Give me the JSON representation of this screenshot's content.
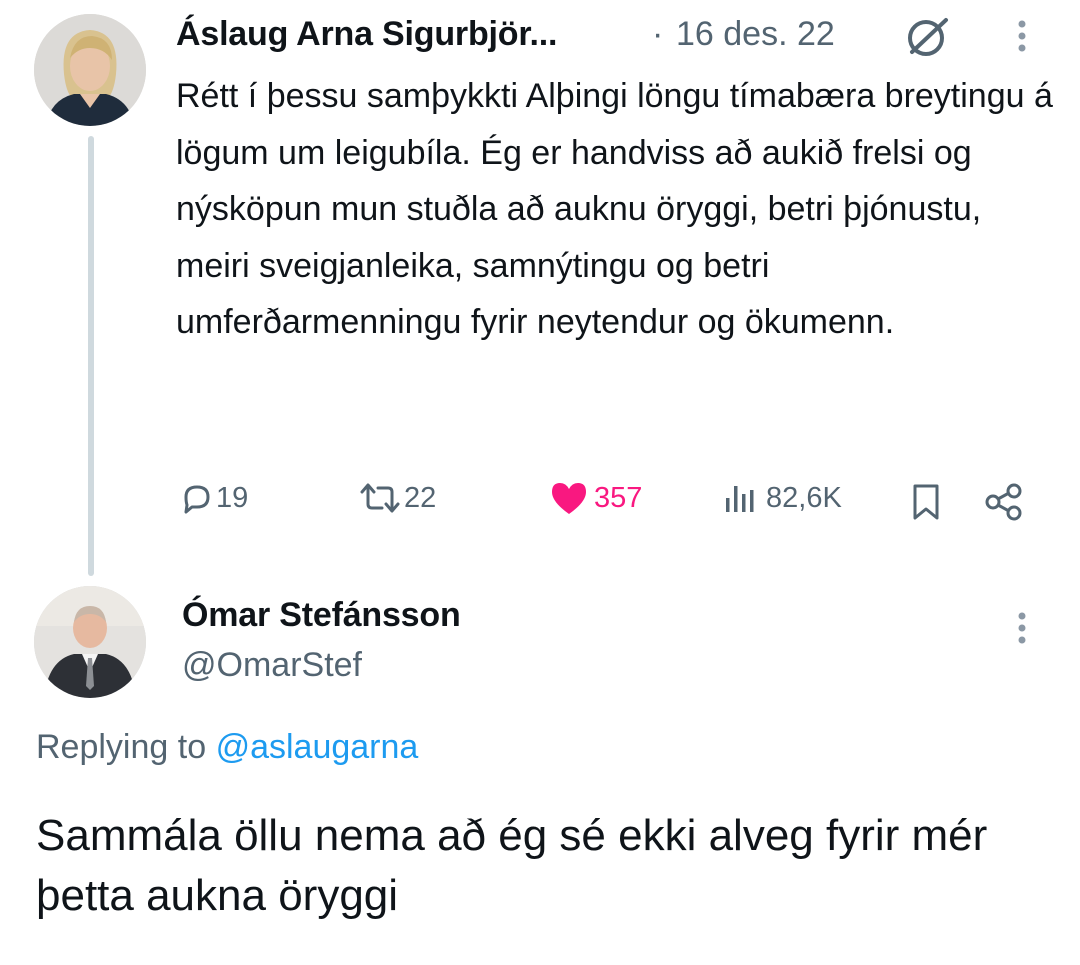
{
  "tweet": {
    "author_name": "Áslaug Arna Sigurbjör...",
    "separator": "·",
    "date": "16 des. 22",
    "text": "Rétt í þessu samþykkti Alþingi löngu tímabæra breytingu á lögum um leigubíla. Ég er handviss að aukið frelsi og nýsköpun mun stuðla að auknu öryggi, betri þjónustu, meiri sveigjanleika, samnýtingu og betri umferðarmenningu fyrir neytendur og ökumenn.",
    "actions": {
      "replies": "19",
      "retweets": "22",
      "likes": "357",
      "views": "82,6K"
    },
    "colors": {
      "like": "#f91880",
      "muted": "#536471"
    }
  },
  "reply": {
    "author_name": "Ómar Stefánsson",
    "handle": "@OmarStef",
    "replying_prefix": "Replying to",
    "replying_handle": "@aslaugarna",
    "text": "Sammála öllu nema að ég sé ekki alveg fyrir mér þetta aukna öryggi",
    "colors": {
      "link": "#1d9bf0"
    }
  },
  "icons": {
    "no_entry": "circle-slash-icon",
    "more": "more-vertical-icon",
    "reply": "comment-icon",
    "retweet": "retweet-icon",
    "like": "heart-icon",
    "views": "bar-chart-icon",
    "bookmark": "bookmark-icon",
    "share": "share-icon"
  }
}
